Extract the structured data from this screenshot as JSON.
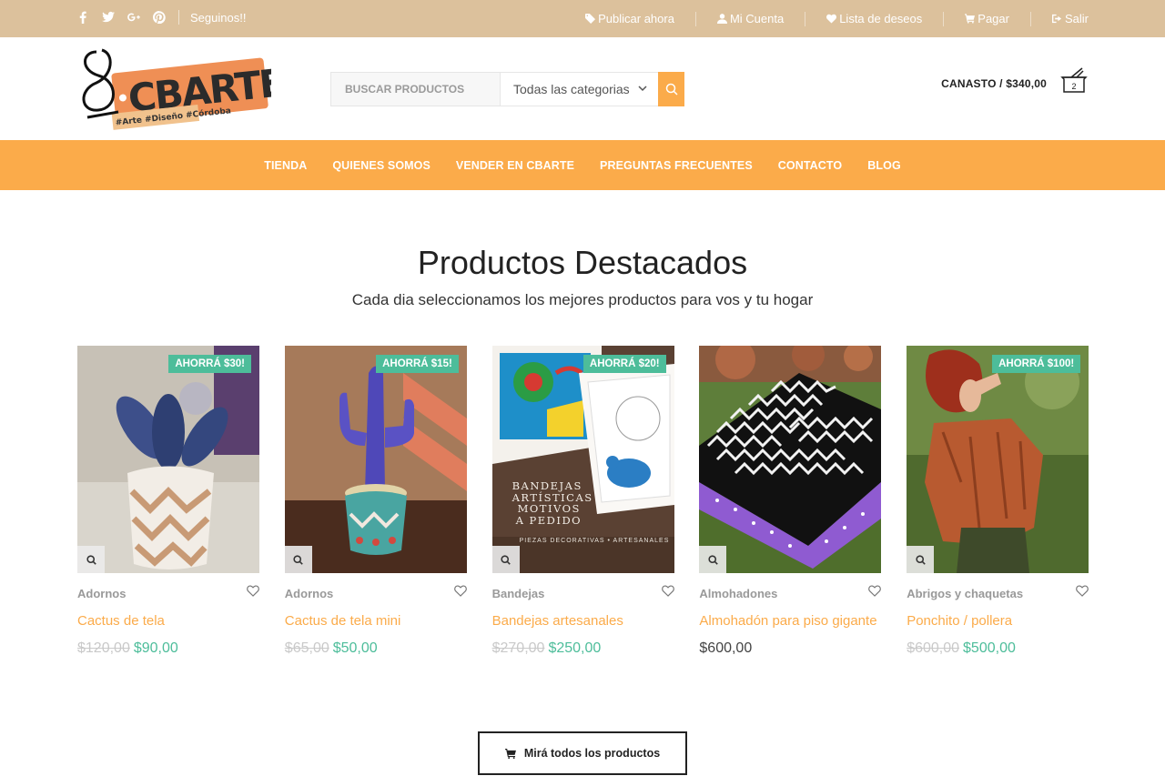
{
  "topbar": {
    "social_icons": [
      "facebook-icon",
      "twitter-icon",
      "google-plus-icon",
      "pinterest-icon"
    ],
    "follow_label": "Seguinos!!",
    "links": [
      {
        "label": "Publicar ahora",
        "icon": "tag-icon"
      },
      {
        "label": "Mi Cuenta",
        "icon": "user-icon"
      },
      {
        "label": "Lista de deseos",
        "icon": "heart-icon"
      },
      {
        "label": "Pagar",
        "icon": "cart-icon"
      },
      {
        "label": "Salir",
        "icon": "sign-out-icon"
      }
    ]
  },
  "header": {
    "logo_text": "CBARTE",
    "logo_tagline": "#Arte #Diseño #Córdoba",
    "search": {
      "placeholder": "BUSCAR PRODUCTOS",
      "category": "Todas las categorias"
    },
    "cart": {
      "label": "CANASTO / $340,00",
      "count": "2"
    }
  },
  "nav": {
    "items": [
      "TIENDA",
      "QUIENES SOMOS",
      "VENDER EN CBARTE",
      "PREGUNTAS FRECUENTES",
      "CONTACTO",
      "BLOG"
    ]
  },
  "section": {
    "title": "Productos Destacados",
    "subtitle": "Cada dia seleccionamos los mejores productos para vos y tu hogar"
  },
  "products": [
    {
      "badge": "AHORRÁ $30!",
      "category": "Adornos",
      "name": "Cactus de tela",
      "old_price": "$120,00",
      "price": "$90,00"
    },
    {
      "badge": "AHORRÁ $15!",
      "category": "Adornos",
      "name": "Cactus de tela mini",
      "old_price": "$65,00",
      "price": "$50,00"
    },
    {
      "badge": "AHORRÁ $20!",
      "category": "Bandejas",
      "name": "Bandejas artesanales",
      "old_price": "$270,00",
      "price": "$250,00",
      "image_text": [
        "BANDEJAS",
        "ARTÍSTICAS",
        "MOTIVOS",
        "A PEDIDO",
        "PIEZAS DECORATIVAS • ARTESANALES"
      ]
    },
    {
      "badge": "",
      "category": "Almohadones",
      "name": "Almohadón para piso gigante",
      "old_price": "",
      "price": "$600,00"
    },
    {
      "badge": "AHORRÁ $100!",
      "category": "Abrigos y chaquetas",
      "name": "Ponchito / pollera",
      "old_price": "$600,00",
      "price": "$500,00"
    }
  ],
  "cta": {
    "label": "Mirá todos los productos"
  },
  "colors": {
    "accent": "#fbab4a",
    "sale": "#4dbd9a",
    "topbar": "#dcc19c"
  }
}
